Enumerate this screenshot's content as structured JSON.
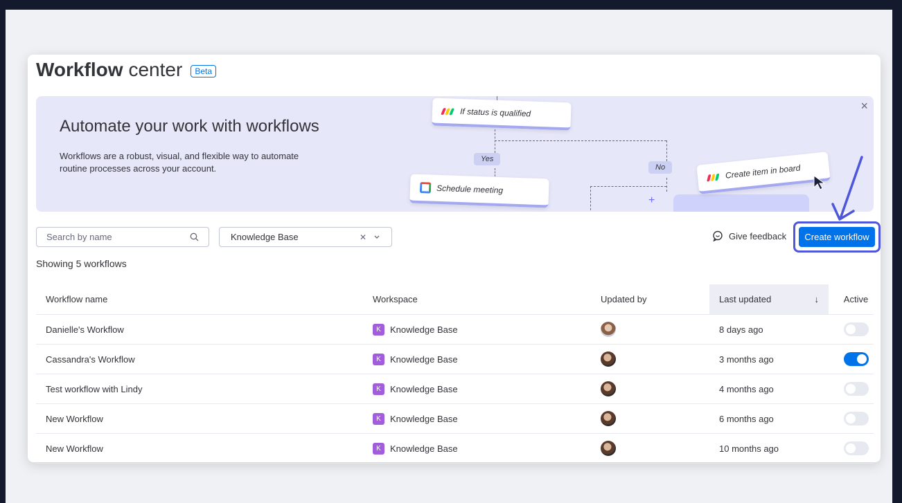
{
  "header": {
    "title_bold": "Workflow",
    "title_light": "center",
    "badge": "Beta"
  },
  "banner": {
    "title": "Automate your work with workflows",
    "description": "Workflows are a robust, visual, and flexible way to automate routine processes across your account.",
    "close_icon": "×",
    "flow": {
      "condition": "If status is qualified",
      "yes": "Yes",
      "no": "No",
      "action_meeting": "Schedule meeting",
      "action_create": "Create item in board",
      "plus": "+"
    }
  },
  "controls": {
    "search_placeholder": "Search by name",
    "workspace_filter": "Knowledge Base",
    "feedback_label": "Give feedback",
    "create_label": "Create workflow"
  },
  "summary": "Showing 5 workflows",
  "table": {
    "columns": {
      "name": "Workflow name",
      "workspace": "Workspace",
      "updated_by": "Updated by",
      "last_updated": "Last updated",
      "sort_icon": "↓",
      "active": "Active"
    },
    "rows": [
      {
        "name": "Danielle's Workflow",
        "badge": "K",
        "workspace": "Knowledge Base",
        "updated": "8 days ago",
        "active": false
      },
      {
        "name": "Cassandra's Workflow",
        "badge": "K",
        "workspace": "Knowledge Base",
        "updated": "3 months ago",
        "active": true
      },
      {
        "name": "Test workflow with Lindy",
        "badge": "K",
        "workspace": "Knowledge Base",
        "updated": "4 months ago",
        "active": false
      },
      {
        "name": "New Workflow",
        "badge": "K",
        "workspace": "Knowledge Base",
        "updated": "6 months ago",
        "active": false
      },
      {
        "name": "New Workflow",
        "badge": "K",
        "workspace": "Knowledge Base",
        "updated": "10 months ago",
        "active": false
      }
    ]
  },
  "colors": {
    "primary": "#0073ea",
    "banner_bg": "#e6e7f9",
    "workspace_badge": "#a25ddc",
    "highlight_outline": "#4e56d9"
  },
  "icons": [
    "search-icon",
    "close-icon",
    "chevron-down-icon",
    "feedback-icon",
    "sort-arrow-icon",
    "monday-logo-icon",
    "calendar-icon",
    "cursor-icon",
    "arrow-annotation-icon"
  ]
}
